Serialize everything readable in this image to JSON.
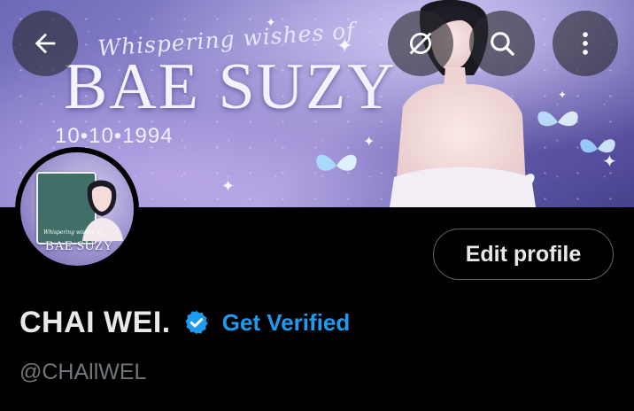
{
  "banner": {
    "script_text": "Whispering wishes of",
    "title": "BAE SUZY",
    "date": "10•10•1994"
  },
  "header_buttons": {
    "back_icon": "arrow-left-icon",
    "hide_icon": "eye-slash-icon",
    "search_icon": "search-icon",
    "more_icon": "more-vertical-icon"
  },
  "avatar": {
    "script_text": "Whispering wishes of",
    "title": "BAE SUZY"
  },
  "profile": {
    "edit_label": "Edit profile",
    "display_name": "CHAI WEI.",
    "verified_icon": "verified-badge-icon",
    "get_verified_label": "Get Verified",
    "handle": "@CHAllWEL"
  },
  "colors": {
    "background": "#000000",
    "text_primary": "#e7e9ea",
    "text_secondary": "#71767b",
    "accent": "#1d9bf0"
  }
}
